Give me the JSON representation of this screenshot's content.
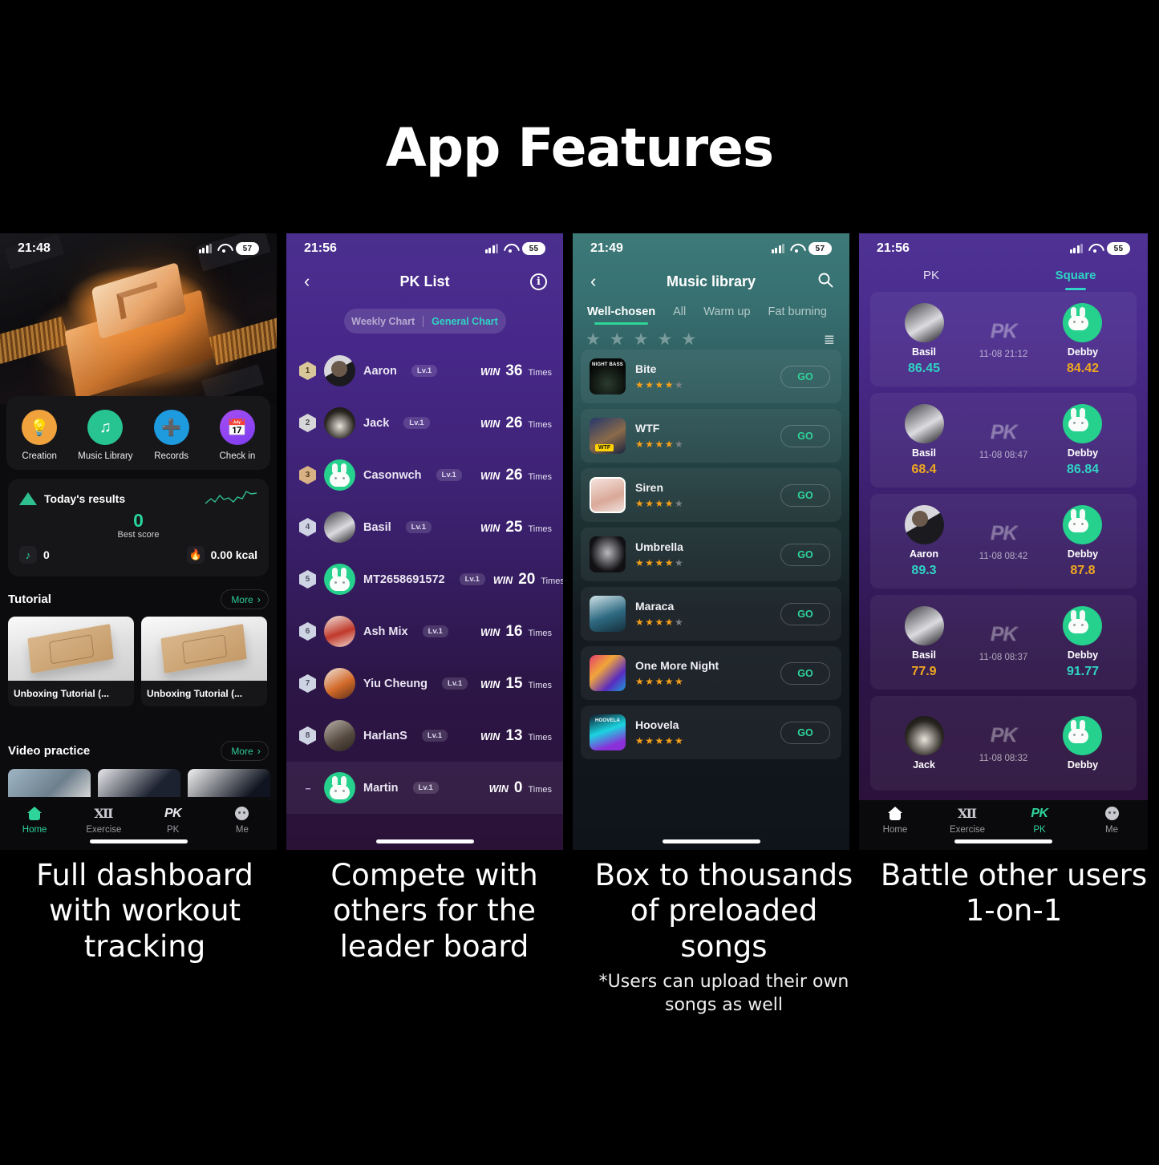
{
  "title": "App Features",
  "phones": [
    {
      "id": "dashboard",
      "statusbar": {
        "time": "21:48",
        "battery": "57"
      },
      "quick_actions": [
        {
          "label": "Creation",
          "icon": "lightbulb-icon",
          "color": "#f0a33c"
        },
        {
          "label": "Music Library",
          "icon": "music-note-icon",
          "color": "#27c492"
        },
        {
          "label": "Records",
          "icon": "records-icon",
          "color": "#1e9ade"
        },
        {
          "label": "Check in",
          "icon": "calendar-check-icon",
          "color": "#9b4df0"
        }
      ],
      "results": {
        "title": "Today's results",
        "score": "0",
        "score_caption": "Best score",
        "notes": "0",
        "calories": "0.00 kcal"
      },
      "tutorial": {
        "heading": "Tutorial",
        "more": "More",
        "cards": [
          {
            "caption": "Unboxing Tutorial (..."
          },
          {
            "caption": "Unboxing Tutorial (..."
          }
        ]
      },
      "video_practice": {
        "heading": "Video practice",
        "more": "More"
      },
      "tabbar": [
        {
          "label": "Home",
          "icon": "home-icon",
          "active": true
        },
        {
          "label": "Exercise",
          "icon": "exercise-icon",
          "active": false
        },
        {
          "label": "PK",
          "icon": "pk-icon",
          "active": false
        },
        {
          "label": "Me",
          "icon": "profile-icon",
          "active": false
        }
      ]
    },
    {
      "id": "pk-list",
      "statusbar": {
        "time": "21:56",
        "battery": "55"
      },
      "nav": {
        "title": "PK List",
        "back": "‹",
        "info": "i"
      },
      "segmented": {
        "left": "Weekly Chart",
        "right": "General Chart",
        "selected": "General Chart"
      },
      "rows": [
        {
          "rank": "1",
          "name": "Aaron",
          "level": "Lv.1",
          "win": "WIN",
          "count": "36",
          "times": "Times"
        },
        {
          "rank": "2",
          "name": "Jack",
          "level": "Lv.1",
          "win": "WIN",
          "count": "26",
          "times": "Times"
        },
        {
          "rank": "3",
          "name": "Casonwch",
          "level": "Lv.1",
          "win": "WIN",
          "count": "26",
          "times": "Times"
        },
        {
          "rank": "4",
          "name": "Basil",
          "level": "Lv.1",
          "win": "WIN",
          "count": "25",
          "times": "Times"
        },
        {
          "rank": "5",
          "name": "MT2658691572",
          "level": "Lv.1",
          "win": "WIN",
          "count": "20",
          "times": "Times"
        },
        {
          "rank": "6",
          "name": "Ash Mix",
          "level": "Lv.1",
          "win": "WIN",
          "count": "16",
          "times": "Times"
        },
        {
          "rank": "7",
          "name": "Yiu Cheung",
          "level": "Lv.1",
          "win": "WIN",
          "count": "15",
          "times": "Times"
        },
        {
          "rank": "8",
          "name": "HarlanS",
          "level": "Lv.1",
          "win": "WIN",
          "count": "13",
          "times": "Times"
        },
        {
          "rank": "--",
          "name": "Martin",
          "level": "Lv.1",
          "win": "WIN",
          "count": "0",
          "times": "Times"
        }
      ]
    },
    {
      "id": "music-library",
      "statusbar": {
        "time": "21:49",
        "battery": "57"
      },
      "nav": {
        "title": "Music library",
        "back": "‹",
        "search": "search-icon"
      },
      "tabs": [
        {
          "label": "Well-chosen",
          "active": true
        },
        {
          "label": "All",
          "active": false
        },
        {
          "label": "Warm up",
          "active": false
        },
        {
          "label": "Fat burning",
          "active": false
        }
      ],
      "filter_stars": 5,
      "songs": [
        {
          "name": "Bite",
          "rating": 4,
          "go": "GO"
        },
        {
          "name": "WTF",
          "rating": 4,
          "go": "GO"
        },
        {
          "name": "Siren",
          "rating": 4,
          "go": "GO"
        },
        {
          "name": "Umbrella",
          "rating": 4,
          "go": "GO"
        },
        {
          "name": "Maraca",
          "rating": 4,
          "go": "GO"
        },
        {
          "name": "One More Night",
          "rating": 5,
          "go": "GO"
        },
        {
          "name": "Hoovela",
          "rating": 5,
          "go": "GO"
        }
      ]
    },
    {
      "id": "square",
      "statusbar": {
        "time": "21:56",
        "battery": "55"
      },
      "tabs": [
        {
          "label": "PK",
          "active": false
        },
        {
          "label": "Square",
          "active": true
        }
      ],
      "matches": [
        {
          "left_name": "Basil",
          "left_score": "86.45",
          "left_result": "win",
          "time": "11-08 21:12",
          "right_name": "Debby",
          "right_score": "84.42",
          "right_result": "lose",
          "badge": "PK"
        },
        {
          "left_name": "Basil",
          "left_score": "68.4",
          "left_result": "lose",
          "time": "11-08 08:47",
          "right_name": "Debby",
          "right_score": "86.84",
          "right_result": "win",
          "badge": "PK"
        },
        {
          "left_name": "Aaron",
          "left_score": "89.3",
          "left_result": "win",
          "time": "11-08 08:42",
          "right_name": "Debby",
          "right_score": "87.8",
          "right_result": "lose",
          "badge": "PK"
        },
        {
          "left_name": "Basil",
          "left_score": "77.9",
          "left_result": "lose",
          "time": "11-08 08:37",
          "right_name": "Debby",
          "right_score": "91.77",
          "right_result": "win",
          "badge": "PK"
        },
        {
          "left_name": "Jack",
          "left_score": "",
          "left_result": "",
          "time": "11-08 08:32",
          "right_name": "Debby",
          "right_score": "",
          "right_result": "",
          "badge": "PK"
        }
      ],
      "tabbar": [
        {
          "label": "Home",
          "icon": "home-icon",
          "active": false
        },
        {
          "label": "Exercise",
          "icon": "exercise-icon",
          "active": false
        },
        {
          "label": "PK",
          "icon": "pk-icon",
          "active": true
        },
        {
          "label": "Me",
          "icon": "profile-icon",
          "active": false
        }
      ]
    }
  ],
  "captions": [
    {
      "main": "Full dashboard with workout tracking",
      "sub": ""
    },
    {
      "main": "Compete with others for the leader board",
      "sub": ""
    },
    {
      "main": "Box to thousands of preloaded songs",
      "sub": "*Users can upload their own songs as well"
    },
    {
      "main": "Battle other users 1-on-1",
      "sub": ""
    }
  ],
  "colors": {
    "accent_green": "#2fd49a",
    "accent_teal": "#2fd4c4",
    "accent_orange": "#f0a81f",
    "star_on": "#f6a01a"
  }
}
